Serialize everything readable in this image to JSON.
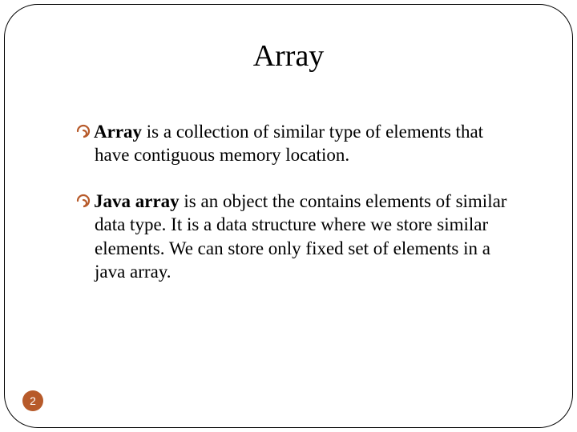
{
  "title": "Array",
  "bullets": [
    {
      "lead": "Array",
      "rest": " is a collection of similar type of elements that have contiguous memory location."
    },
    {
      "lead": "Java array",
      "rest": " is an object the contains elements of similar data type. It is a data structure where we store similar elements. We can store only fixed set of elements in a java array."
    }
  ],
  "page_number": "2"
}
